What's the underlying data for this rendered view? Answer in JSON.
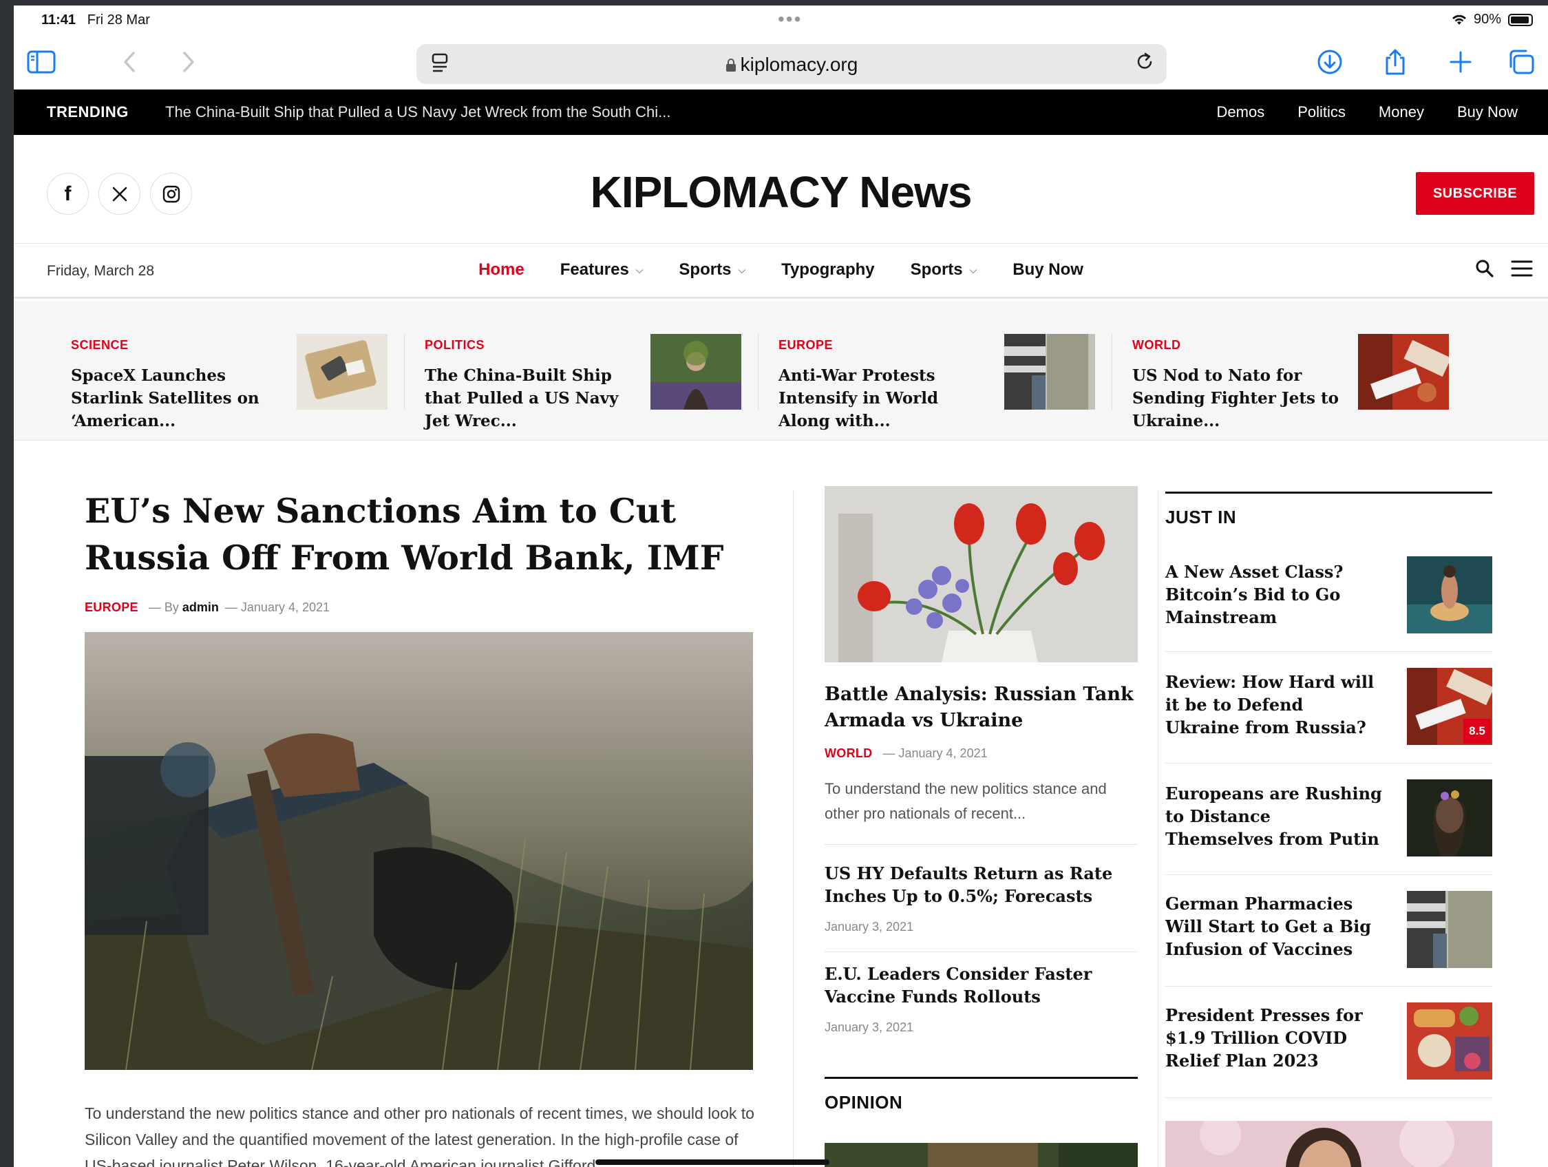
{
  "status": {
    "time": "11:41",
    "date": "Fri 28 Mar",
    "battery": "90%"
  },
  "browser": {
    "url": "kiplomacy.org"
  },
  "trending": {
    "label": "TRENDING",
    "headline": "The China-Built Ship that Pulled a US Navy Jet Wreck from the South Chi...",
    "links": [
      "Demos",
      "Politics",
      "Money",
      "Buy Now"
    ]
  },
  "header": {
    "social_icons": [
      "facebook-icon",
      "x-icon",
      "instagram-icon"
    ],
    "logo": "KIPLOMACY News",
    "subscribe": "SUBSCRIBE"
  },
  "nav": {
    "date": "Friday, March 28",
    "items": [
      {
        "label": "Home",
        "active": true,
        "dropdown": false
      },
      {
        "label": "Features",
        "active": false,
        "dropdown": true
      },
      {
        "label": "Sports",
        "active": false,
        "dropdown": true
      },
      {
        "label": "Typography",
        "active": false,
        "dropdown": false
      },
      {
        "label": "Sports",
        "active": false,
        "dropdown": true
      },
      {
        "label": "Buy Now",
        "active": false,
        "dropdown": false
      }
    ]
  },
  "featured": [
    {
      "category": "SCIENCE",
      "title": "SpaceX Launches Starlink Satellites on ‘American..."
    },
    {
      "category": "POLITICS",
      "title": "The China-Built Ship that Pulled a US Navy Jet Wrec..."
    },
    {
      "category": "EUROPE",
      "title": "Anti-War Protests Intensify in World Along with..."
    },
    {
      "category": "WORLD",
      "title": "US Nod to Nato for Sending Fighter Jets to Ukraine..."
    }
  ],
  "main": {
    "title": "EU’s New Sanctions Aim to Cut Russia Off From World Bank, IMF",
    "category": "EUROPE",
    "by": "— By",
    "author": "admin",
    "date": "— January 4, 2021",
    "excerpt": "To understand the new politics stance and other pro nationals of recent times, we should look to Silicon Valley and the quantified movement of the latest generation. In the high-profile case of US-based journalist Peter Wilson, 16-year-old American journalist Gifford"
  },
  "middle": {
    "feature_title": "Battle Analysis: Russian Tank Armada vs Ukraine",
    "feature_category": "WORLD",
    "feature_date": "— January 4, 2021",
    "feature_excerpt": "To understand the new politics stance and other pro nationals of recent...",
    "items": [
      {
        "title": "US HY Defaults Return as Rate Inches Up to 0.5%; Forecasts",
        "date": "January 3, 2021"
      },
      {
        "title": "E.U. Leaders Consider Faster Vaccine Funds Rollouts",
        "date": "January 3, 2021"
      }
    ],
    "opinion_heading": "OPINION"
  },
  "just_in": {
    "heading": "JUST IN",
    "items": [
      {
        "title": "A New Asset Class? Bitcoin’s Bid to Go Mainstream"
      },
      {
        "title": "Review: How Hard will it be to Defend Ukraine from Russia?",
        "score": "8.5"
      },
      {
        "title": "Europeans are Rushing to Distance Themselves from Putin"
      },
      {
        "title": "German Pharmacies Will Start to Get a Big Infusion of Vaccines"
      },
      {
        "title": "President Presses for $1.9 Trillion COVID Relief Plan 2023"
      }
    ]
  },
  "colors": {
    "accent": "#e0001b",
    "ios_blue": "#1a7cf5"
  }
}
